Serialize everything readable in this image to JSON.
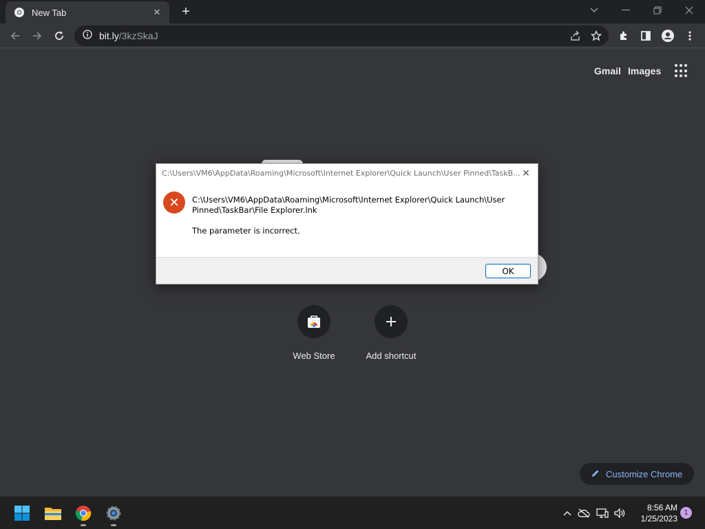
{
  "browser": {
    "tab_title": "New Tab",
    "url_host": "bit.ly",
    "url_path": "/3kzSkaJ"
  },
  "ntp": {
    "gmail": "Gmail",
    "images": "Images",
    "shortcuts": [
      {
        "label": "Web Store",
        "icon": "web-store-icon"
      },
      {
        "label": "Add shortcut",
        "icon": "plus-icon"
      }
    ],
    "customize": "Customize Chrome"
  },
  "dialog": {
    "title": "C:\\Users\\VM6\\AppData\\Roaming\\Microsoft\\Internet Explorer\\Quick Launch\\User Pinned\\TaskB...",
    "message_line1": "C:\\Users\\VM6\\AppData\\Roaming\\Microsoft\\Internet Explorer\\Quick Launch\\User",
    "message_line2": "Pinned\\TaskBar\\File Explorer.lnk",
    "detail": "The parameter is incorrect.",
    "ok_label": "OK",
    "icon": "error-icon"
  },
  "taskbar": {
    "time": "8:56 AM",
    "date": "1/25/2023",
    "notification_count": "1"
  },
  "colors": {
    "accent": "#8ab4f8",
    "error": "#d8491f",
    "background": "#35363a"
  }
}
